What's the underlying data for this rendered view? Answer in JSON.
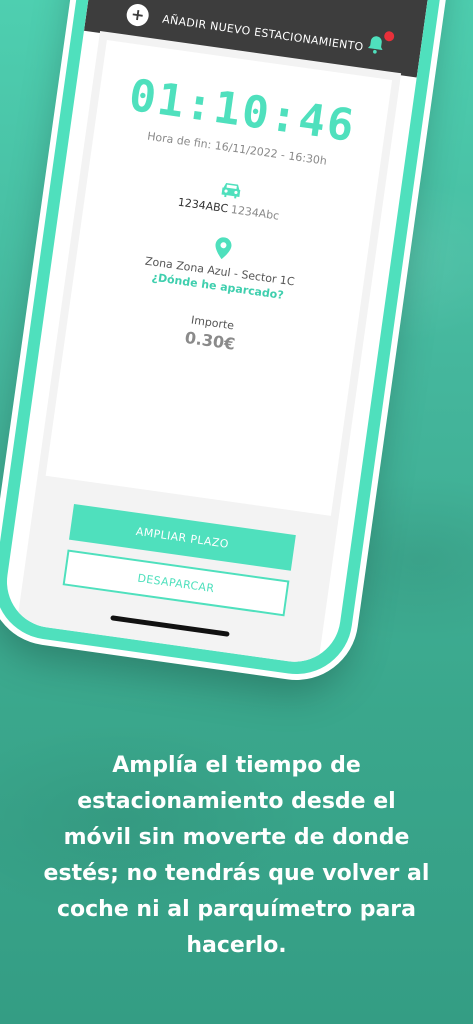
{
  "header": {
    "add_label": "AÑADIR NUEVO ESTACIONAMIENTO",
    "add_icon": "plus-circle-icon",
    "bell_icon": "bell-icon"
  },
  "parking": {
    "timer": "01:10:46",
    "end_time": "Hora de fin: 16/11/2022 - 16:30h",
    "car_icon": "car-icon",
    "plate": "1234ABC",
    "plate_alias": "1234Abc",
    "pin_icon": "location-pin-icon",
    "zone": "Zona Zona Azul - Sector 1C",
    "where_link": "¿Dónde he aparcado?",
    "amount_label": "Importe",
    "amount": "0.30€"
  },
  "actions": {
    "extend_label": "AMPLIAR PLAZO",
    "unpark_label": "DESAPARCAR"
  },
  "caption": "Amplía el tiempo de estacionamiento desde el móvil sin moverte de donde estés; no tendrás que volver al coche ni al parquímetro para hacerlo.",
  "colors": {
    "accent": "#4fe0bd",
    "header": "#3d3d3d",
    "background": "#45b79d",
    "badge": "#e8303a"
  }
}
